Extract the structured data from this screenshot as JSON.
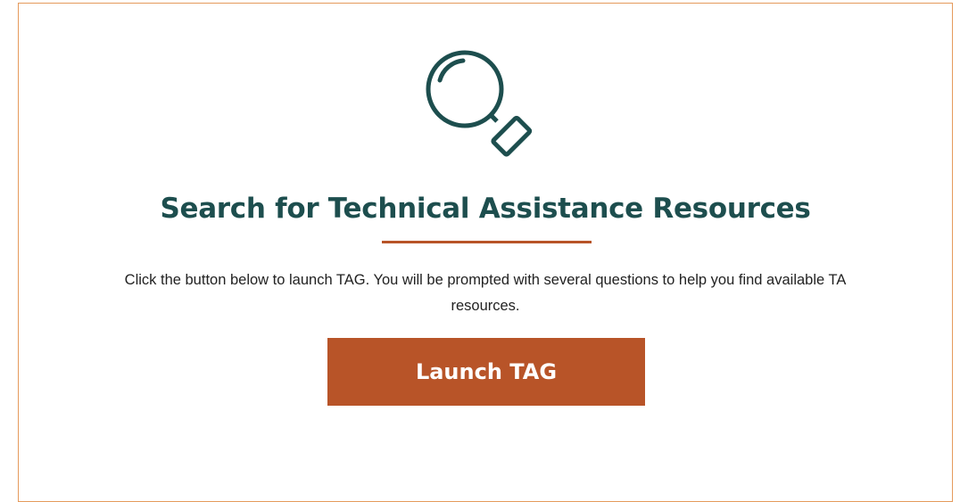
{
  "card": {
    "title": "Search for Technical Assistance Resources",
    "description_line1": "Click the button below to launch TAG. You will be prompted with several questions to help you find available TA",
    "description_line2": "resources.",
    "button_label": "Launch TAG",
    "icon": "magnifying-glass-icon"
  },
  "colors": {
    "title": "#1d4e4e",
    "accent": "#b85428",
    "border": "#e59a5c"
  }
}
